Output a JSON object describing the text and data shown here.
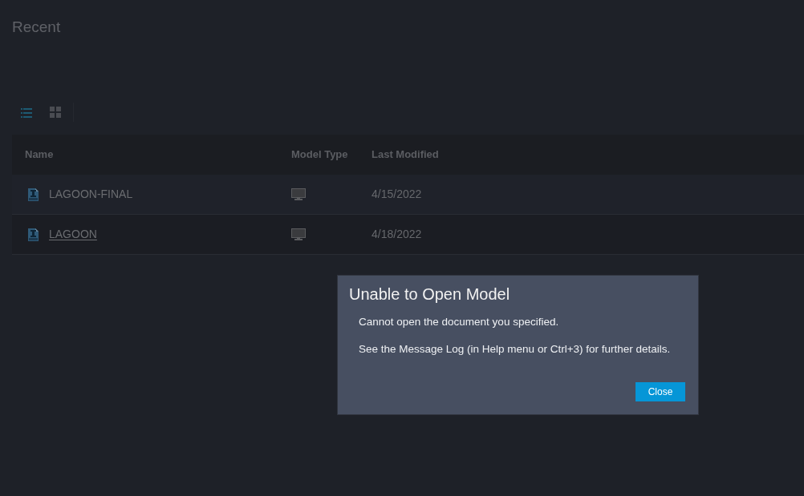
{
  "page": {
    "title": "Recent"
  },
  "view_toggle": [
    {
      "kind": "list",
      "selected": true
    },
    {
      "kind": "grid",
      "selected": false
    }
  ],
  "table": {
    "columns": [
      "Name",
      "Model Type",
      "Last Modified"
    ],
    "rows": [
      {
        "name": "LAGOON-FINAL",
        "hovered": false,
        "last_modified": "4/15/2022"
      },
      {
        "name": "LAGOON",
        "hovered": true,
        "last_modified": "4/18/2022"
      }
    ]
  },
  "dialog": {
    "title": "Unable to Open Model",
    "messages": [
      "Cannot open the document you specified.",
      "See the Message Log (in Help menu or Ctrl+3) for further details."
    ],
    "buttons": [
      "Close"
    ]
  }
}
